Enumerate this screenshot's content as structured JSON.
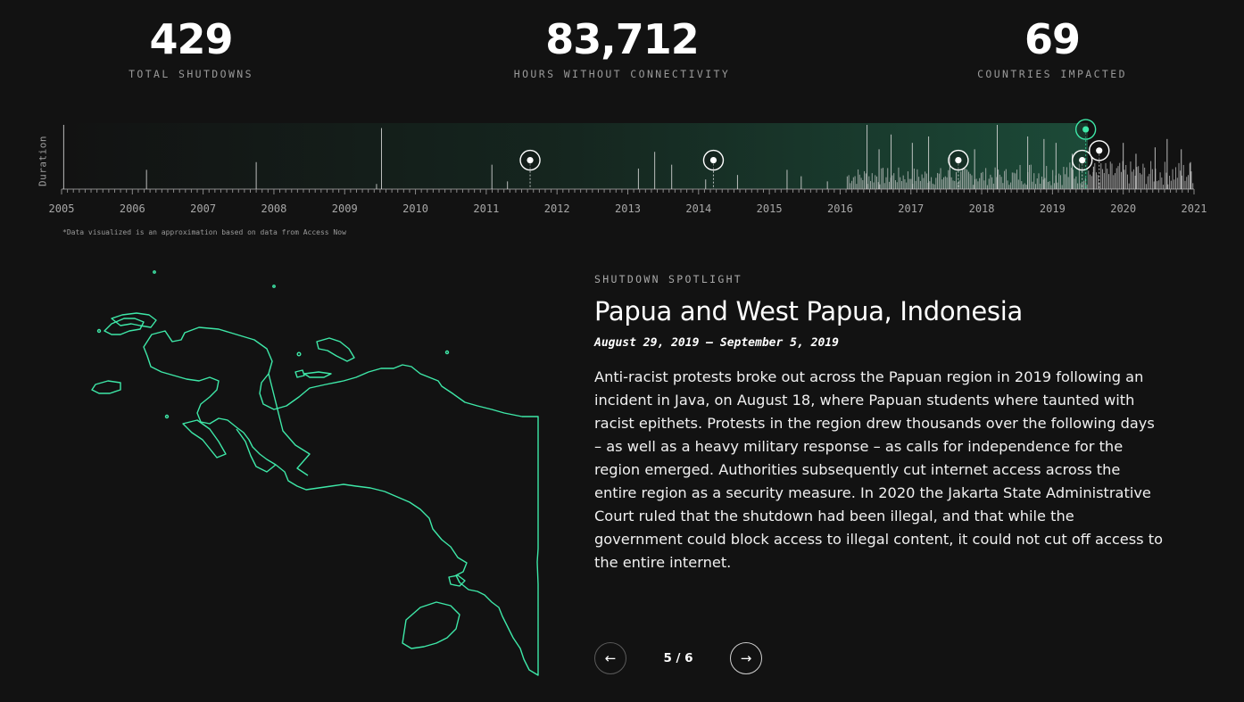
{
  "stats": [
    {
      "value": "429",
      "label": "TOTAL SHUTDOWNS"
    },
    {
      "value": "83,712",
      "label": "HOURS WITHOUT CONNECTIVITY"
    },
    {
      "value": "69",
      "label": "COUNTRIES IMPACTED"
    }
  ],
  "timeline": {
    "ylabel": "Duration",
    "years": [
      "2005",
      "2006",
      "2007",
      "2008",
      "2009",
      "2010",
      "2011",
      "2012",
      "2013",
      "2014",
      "2015",
      "2016",
      "2017",
      "2018",
      "2019",
      "2020",
      "2021"
    ],
    "note": "*Data visualized is an approximation based on data from Access Now",
    "accent_color": "#3ee8a8",
    "highlight_start": "2013",
    "highlight_end": "2019.5",
    "markers": [
      {
        "year": 2011.62,
        "level": 0.45,
        "active": false
      },
      {
        "year": 2014.21,
        "level": 0.45,
        "active": false
      },
      {
        "year": 2017.67,
        "level": 0.45,
        "active": false
      },
      {
        "year": 2019.42,
        "level": 0.45,
        "active": false
      },
      {
        "year": 2019.47,
        "level": 0.93,
        "active": true
      },
      {
        "year": 2019.66,
        "level": 0.6,
        "active": false
      }
    ],
    "bars": [
      {
        "year": 2005.03,
        "level": 1.0
      },
      {
        "year": 2006.2,
        "level": 0.3
      },
      {
        "year": 2007.75,
        "level": 0.42
      },
      {
        "year": 2009.45,
        "level": 0.08
      },
      {
        "year": 2009.52,
        "level": 0.95
      },
      {
        "year": 2011.08,
        "level": 0.38
      },
      {
        "year": 2011.3,
        "level": 0.12
      },
      {
        "year": 2013.15,
        "level": 0.32
      },
      {
        "year": 2013.38,
        "level": 0.58
      },
      {
        "year": 2013.62,
        "level": 0.38
      },
      {
        "year": 2014.1,
        "level": 0.15
      },
      {
        "year": 2014.55,
        "level": 0.22
      },
      {
        "year": 2015.25,
        "level": 0.3
      },
      {
        "year": 2015.45,
        "level": 0.2
      },
      {
        "year": 2015.82,
        "level": 0.12
      },
      {
        "year": 2016.38,
        "level": 1.0
      },
      {
        "year": 2016.55,
        "level": 0.62
      },
      {
        "year": 2016.72,
        "level": 0.85
      },
      {
        "year": 2017.02,
        "level": 0.72
      },
      {
        "year": 2017.25,
        "level": 0.82
      },
      {
        "year": 2017.55,
        "level": 0.5
      },
      {
        "year": 2017.9,
        "level": 0.62
      },
      {
        "year": 2018.22,
        "level": 1.0
      },
      {
        "year": 2018.65,
        "level": 0.82
      },
      {
        "year": 2018.88,
        "level": 0.78
      },
      {
        "year": 2019.05,
        "level": 0.72
      },
      {
        "year": 2019.28,
        "level": 0.55
      },
      {
        "year": 2019.58,
        "level": 0.35
      },
      {
        "year": 2020.0,
        "level": 0.72
      },
      {
        "year": 2020.18,
        "level": 0.55
      },
      {
        "year": 2020.45,
        "level": 0.65
      },
      {
        "year": 2020.62,
        "level": 0.78
      },
      {
        "year": 2020.82,
        "level": 0.62
      },
      {
        "year": 2020.95,
        "level": 0.42
      }
    ]
  },
  "spotlight": {
    "kicker": "SHUTDOWN SPOTLIGHT",
    "title": "Papua and West Papua, Indonesia",
    "dates": "August 29, 2019 – September 5, 2019",
    "body": "Anti-racist protests broke out across the Papuan region in 2019 following an incident in Java, on August 18, where Papuan students where taunted with racist epithets. Protests in the region drew thousands over the following days – as well as a heavy military response – as calls for independence for the region emerged. Authorities subsequently cut internet access across the entire region as a security measure. In 2020 the Jakarta State Administrative Court ruled that the shutdown had been illegal, and that while the government could block access to illegal content, it could not cut off access to the entire internet.",
    "page": "5 / 6",
    "prev_icon": "arrow-left-icon",
    "next_icon": "arrow-right-icon",
    "map_color": "#3ee8a8"
  }
}
